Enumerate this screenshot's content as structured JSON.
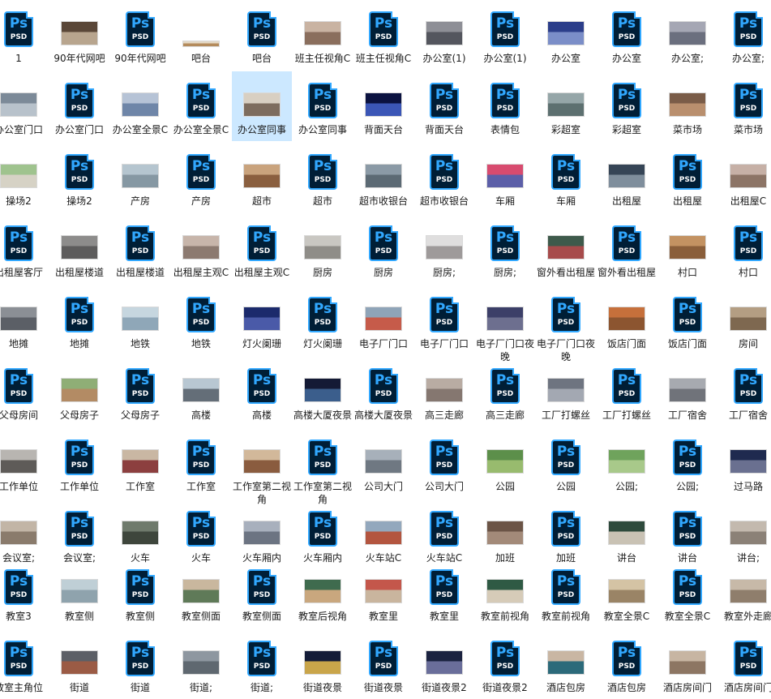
{
  "items": [
    {
      "label": "1",
      "type": "psd"
    },
    {
      "label": "90年代网吧",
      "type": "img",
      "colors": [
        "#5a4738",
        "#b8a58e"
      ]
    },
    {
      "label": "90年代网吧",
      "type": "psd"
    },
    {
      "label": "吧台",
      "type": "img",
      "colors": [
        "#e4d9c7",
        "#b48b5c"
      ],
      "thin": true
    },
    {
      "label": "吧台",
      "type": "psd"
    },
    {
      "label": "班主任视角C",
      "type": "img",
      "colors": [
        "#c9b3a2",
        "#8a6e5d"
      ]
    },
    {
      "label": "班主任视角C",
      "type": "psd"
    },
    {
      "label": "办公室(1)",
      "type": "img",
      "colors": [
        "#8e8f96",
        "#54565e"
      ]
    },
    {
      "label": "办公室(1)",
      "type": "psd"
    },
    {
      "label": "办公室",
      "type": "img",
      "colors": [
        "#2c3e8a",
        "#7b8ec8"
      ]
    },
    {
      "label": "办公室",
      "type": "psd"
    },
    {
      "label": "办公室;",
      "type": "img",
      "colors": [
        "#a5a7b4",
        "#6b6f7e"
      ]
    },
    {
      "label": "办公室;",
      "type": "psd"
    },
    {
      "label": "办公室门口",
      "type": "img",
      "colors": [
        "#7c8a98",
        "#b8c2cb"
      ]
    },
    {
      "label": "办公室门口",
      "type": "psd"
    },
    {
      "label": "办公室全景C",
      "type": "img",
      "colors": [
        "#b6c3d6",
        "#6f86a8"
      ]
    },
    {
      "label": "办公室全景C",
      "type": "psd"
    },
    {
      "label": "办公室同事",
      "type": "img",
      "colors": [
        "#d8cfc2",
        "#7d6c5e"
      ]
    },
    {
      "label": "办公室同事",
      "type": "psd"
    },
    {
      "label": "背面天台",
      "type": "img",
      "colors": [
        "#0b1240",
        "#3b56b6"
      ]
    },
    {
      "label": "背面天台",
      "type": "psd"
    },
    {
      "label": "表情包",
      "type": "psd"
    },
    {
      "label": "彩超室",
      "type": "img",
      "colors": [
        "#95a6a8",
        "#5d7070"
      ]
    },
    {
      "label": "彩超室",
      "type": "psd"
    },
    {
      "label": "菜市场",
      "type": "img",
      "colors": [
        "#7a5c48",
        "#b98f6e"
      ]
    },
    {
      "label": "菜市场",
      "type": "psd"
    },
    {
      "label": "操场2",
      "type": "img",
      "colors": [
        "#9fc38e",
        "#d6d2c5"
      ]
    },
    {
      "label": "操场2",
      "type": "psd"
    },
    {
      "label": "产房",
      "type": "img",
      "colors": [
        "#b5c5cf",
        "#8698a3"
      ]
    },
    {
      "label": "产房",
      "type": "psd"
    },
    {
      "label": "超市",
      "type": "img",
      "colors": [
        "#c9a37d",
        "#8a5f3f"
      ]
    },
    {
      "label": "超市",
      "type": "psd"
    },
    {
      "label": "超市收银台",
      "type": "img",
      "colors": [
        "#8b9aa6",
        "#5c6a74"
      ]
    },
    {
      "label": "超市收银台",
      "type": "psd"
    },
    {
      "label": "车厢",
      "type": "img",
      "colors": [
        "#d84b6f",
        "#5c5fa8"
      ]
    },
    {
      "label": "车厢",
      "type": "psd"
    },
    {
      "label": "出租屋",
      "type": "img",
      "colors": [
        "#364556",
        "#7f8e9c"
      ]
    },
    {
      "label": "出租屋",
      "type": "psd"
    },
    {
      "label": "出租屋C",
      "type": "img",
      "colors": [
        "#c6b0a6",
        "#8c7466"
      ]
    },
    {
      "label": "出租屋客厅",
      "type": "psd"
    },
    {
      "label": "出租屋楼道",
      "type": "img",
      "colors": [
        "#8d8c8b",
        "#5d5c5c"
      ]
    },
    {
      "label": "出租屋楼道",
      "type": "psd"
    },
    {
      "label": "出租屋主观C",
      "type": "img",
      "colors": [
        "#c7b5aa",
        "#8c7a70"
      ]
    },
    {
      "label": "出租屋主观C",
      "type": "psd"
    },
    {
      "label": "厨房",
      "type": "img",
      "colors": [
        "#c9c7c2",
        "#8f8d88"
      ]
    },
    {
      "label": "厨房",
      "type": "psd"
    },
    {
      "label": "厨房;",
      "type": "img",
      "colors": [
        "#dfdede",
        "#9e9a9a"
      ]
    },
    {
      "label": "厨房;",
      "type": "psd"
    },
    {
      "label": "窗外看出租屋",
      "type": "img",
      "colors": [
        "#3e5a4b",
        "#a74b4b"
      ]
    },
    {
      "label": "窗外看出租屋",
      "type": "psd"
    },
    {
      "label": "村口",
      "type": "img",
      "colors": [
        "#c39262",
        "#8a5e3a"
      ]
    },
    {
      "label": "村口",
      "type": "psd"
    },
    {
      "label": "地摊",
      "type": "img",
      "colors": [
        "#8b8f95",
        "#5b5f66"
      ]
    },
    {
      "label": "地摊",
      "type": "psd"
    },
    {
      "label": "地铁",
      "type": "img",
      "colors": [
        "#c6d6df",
        "#8fa7b8"
      ]
    },
    {
      "label": "地铁",
      "type": "psd"
    },
    {
      "label": "灯火阑珊",
      "type": "img",
      "colors": [
        "#1b2a6c",
        "#4a5aa8"
      ]
    },
    {
      "label": "灯火阑珊",
      "type": "psd"
    },
    {
      "label": "电子厂门口",
      "type": "img",
      "colors": [
        "#8fa4b8",
        "#c65b4a"
      ]
    },
    {
      "label": "电子厂门口",
      "type": "psd"
    },
    {
      "label": "电子厂门口夜晚",
      "type": "img",
      "colors": [
        "#3c3f68",
        "#6d6f8f"
      ]
    },
    {
      "label": "电子厂门口夜晚",
      "type": "psd"
    },
    {
      "label": "饭店门面",
      "type": "img",
      "colors": [
        "#c6703b",
        "#8c5530"
      ]
    },
    {
      "label": "饭店门面",
      "type": "psd"
    },
    {
      "label": "房间",
      "type": "img",
      "colors": [
        "#b49e83",
        "#7e6850"
      ]
    },
    {
      "label": "父母房间",
      "type": "psd"
    },
    {
      "label": "父母房子",
      "type": "img",
      "colors": [
        "#8fae76",
        "#b38b64"
      ]
    },
    {
      "label": "父母房子",
      "type": "psd"
    },
    {
      "label": "高楼",
      "type": "img",
      "colors": [
        "#b8c7d2",
        "#646e78"
      ]
    },
    {
      "label": "高楼",
      "type": "psd"
    },
    {
      "label": "高楼大厦夜景",
      "type": "img",
      "colors": [
        "#141a35",
        "#3b5e8c"
      ]
    },
    {
      "label": "高楼大厦夜景",
      "type": "psd"
    },
    {
      "label": "高三走廊",
      "type": "img",
      "colors": [
        "#b9aca3",
        "#857770"
      ]
    },
    {
      "label": "高三走廊",
      "type": "psd"
    },
    {
      "label": "工厂打螺丝",
      "type": "img",
      "colors": [
        "#6e7480",
        "#a3a8b2"
      ]
    },
    {
      "label": "工厂打螺丝",
      "type": "psd"
    },
    {
      "label": "工厂宿舍",
      "type": "img",
      "colors": [
        "#a7aab0",
        "#70737a"
      ]
    },
    {
      "label": "工厂宿舍",
      "type": "psd"
    },
    {
      "label": "工作单位",
      "type": "img",
      "colors": [
        "#b8b5b1",
        "#5e5b58"
      ]
    },
    {
      "label": "工作单位",
      "type": "psd"
    },
    {
      "label": "工作室",
      "type": "img",
      "colors": [
        "#c9b7a3",
        "#8c3f3f"
      ]
    },
    {
      "label": "工作室",
      "type": "psd"
    },
    {
      "label": "工作室第二视角",
      "type": "img",
      "colors": [
        "#d2b89a",
        "#8a5c3f"
      ]
    },
    {
      "label": "工作室第二视角",
      "type": "psd"
    },
    {
      "label": "公司大门",
      "type": "img",
      "colors": [
        "#a7b0ba",
        "#6f7882"
      ]
    },
    {
      "label": "公司大门",
      "type": "psd"
    },
    {
      "label": "公园",
      "type": "img",
      "colors": [
        "#5c8f4a",
        "#98bb6e"
      ]
    },
    {
      "label": "公园",
      "type": "psd"
    },
    {
      "label": "公园;",
      "type": "img",
      "colors": [
        "#6fa35c",
        "#a8c98a"
      ]
    },
    {
      "label": "公园;",
      "type": "psd"
    },
    {
      "label": "过马路",
      "type": "img",
      "colors": [
        "#1f2a4f",
        "#6a7090"
      ]
    },
    {
      "label": "会议室;",
      "type": "img",
      "colors": [
        "#c2b5a6",
        "#8a7b6c"
      ]
    },
    {
      "label": "会议室;",
      "type": "psd"
    },
    {
      "label": "火车",
      "type": "img",
      "colors": [
        "#6f7a6c",
        "#3e463c"
      ]
    },
    {
      "label": "火车",
      "type": "psd"
    },
    {
      "label": "火车厢内",
      "type": "img",
      "colors": [
        "#a8b0bd",
        "#6c7482"
      ]
    },
    {
      "label": "火车厢内",
      "type": "psd"
    },
    {
      "label": "火车站C",
      "type": "img",
      "colors": [
        "#93a8bd",
        "#b3553f"
      ]
    },
    {
      "label": "火车站C",
      "type": "psd"
    },
    {
      "label": "加班",
      "type": "img",
      "colors": [
        "#6b5446",
        "#a38a79"
      ]
    },
    {
      "label": "加班",
      "type": "psd"
    },
    {
      "label": "讲台",
      "type": "img",
      "colors": [
        "#2e4a3c",
        "#c9c2b4"
      ]
    },
    {
      "label": "讲台",
      "type": "psd"
    },
    {
      "label": "讲台;",
      "type": "img",
      "colors": [
        "#c3b9ae",
        "#8b8177"
      ]
    },
    {
      "label": "教室3",
      "type": "psd"
    },
    {
      "label": "教室侧",
      "type": "img",
      "colors": [
        "#bfcfd6",
        "#8fa3ad"
      ]
    },
    {
      "label": "教室侧",
      "type": "psd"
    },
    {
      "label": "教室侧面",
      "type": "img",
      "colors": [
        "#c9b79e",
        "#5f7a58"
      ]
    },
    {
      "label": "教室侧面",
      "type": "psd"
    },
    {
      "label": "教室后视角",
      "type": "img",
      "colors": [
        "#3f6b4e",
        "#c9a77e"
      ]
    },
    {
      "label": "教室里",
      "type": "img",
      "colors": [
        "#c4574b",
        "#c9b59e"
      ]
    },
    {
      "label": "教室里",
      "type": "psd"
    },
    {
      "label": "教室前视角",
      "type": "img",
      "colors": [
        "#2f5a44",
        "#d6cbb8"
      ]
    },
    {
      "label": "教室前视角",
      "type": "psd"
    },
    {
      "label": "教室全景C",
      "type": "img",
      "colors": [
        "#d4c3a4",
        "#9a8466"
      ]
    },
    {
      "label": "教室全景C",
      "type": "psd"
    },
    {
      "label": "教室外走廊",
      "type": "img",
      "colors": [
        "#c7b9a8",
        "#8f7e6c"
      ]
    },
    {
      "label": "教室主角位",
      "type": "psd"
    },
    {
      "label": "街道",
      "type": "img",
      "colors": [
        "#5c5f66",
        "#9b5b45"
      ]
    },
    {
      "label": "街道",
      "type": "psd"
    },
    {
      "label": "街道;",
      "type": "img",
      "colors": [
        "#8e97a0",
        "#5f6870"
      ]
    },
    {
      "label": "街道;",
      "type": "psd"
    },
    {
      "label": "街道夜景",
      "type": "img",
      "colors": [
        "#141c38",
        "#c9a54a"
      ]
    },
    {
      "label": "街道夜景",
      "type": "psd"
    },
    {
      "label": "街道夜景2",
      "type": "img",
      "colors": [
        "#1b2340",
        "#6a6e9a"
      ]
    },
    {
      "label": "街道夜景2",
      "type": "psd"
    },
    {
      "label": "酒店包房",
      "type": "img",
      "colors": [
        "#c9b6a3",
        "#2c6a7a"
      ]
    },
    {
      "label": "酒店包房",
      "type": "psd"
    },
    {
      "label": "酒店房间门",
      "type": "img",
      "colors": [
        "#c7b5a2",
        "#8d7663"
      ]
    },
    {
      "label": "酒店房间门",
      "type": "psd"
    }
  ],
  "selected_label": "办公室同事"
}
